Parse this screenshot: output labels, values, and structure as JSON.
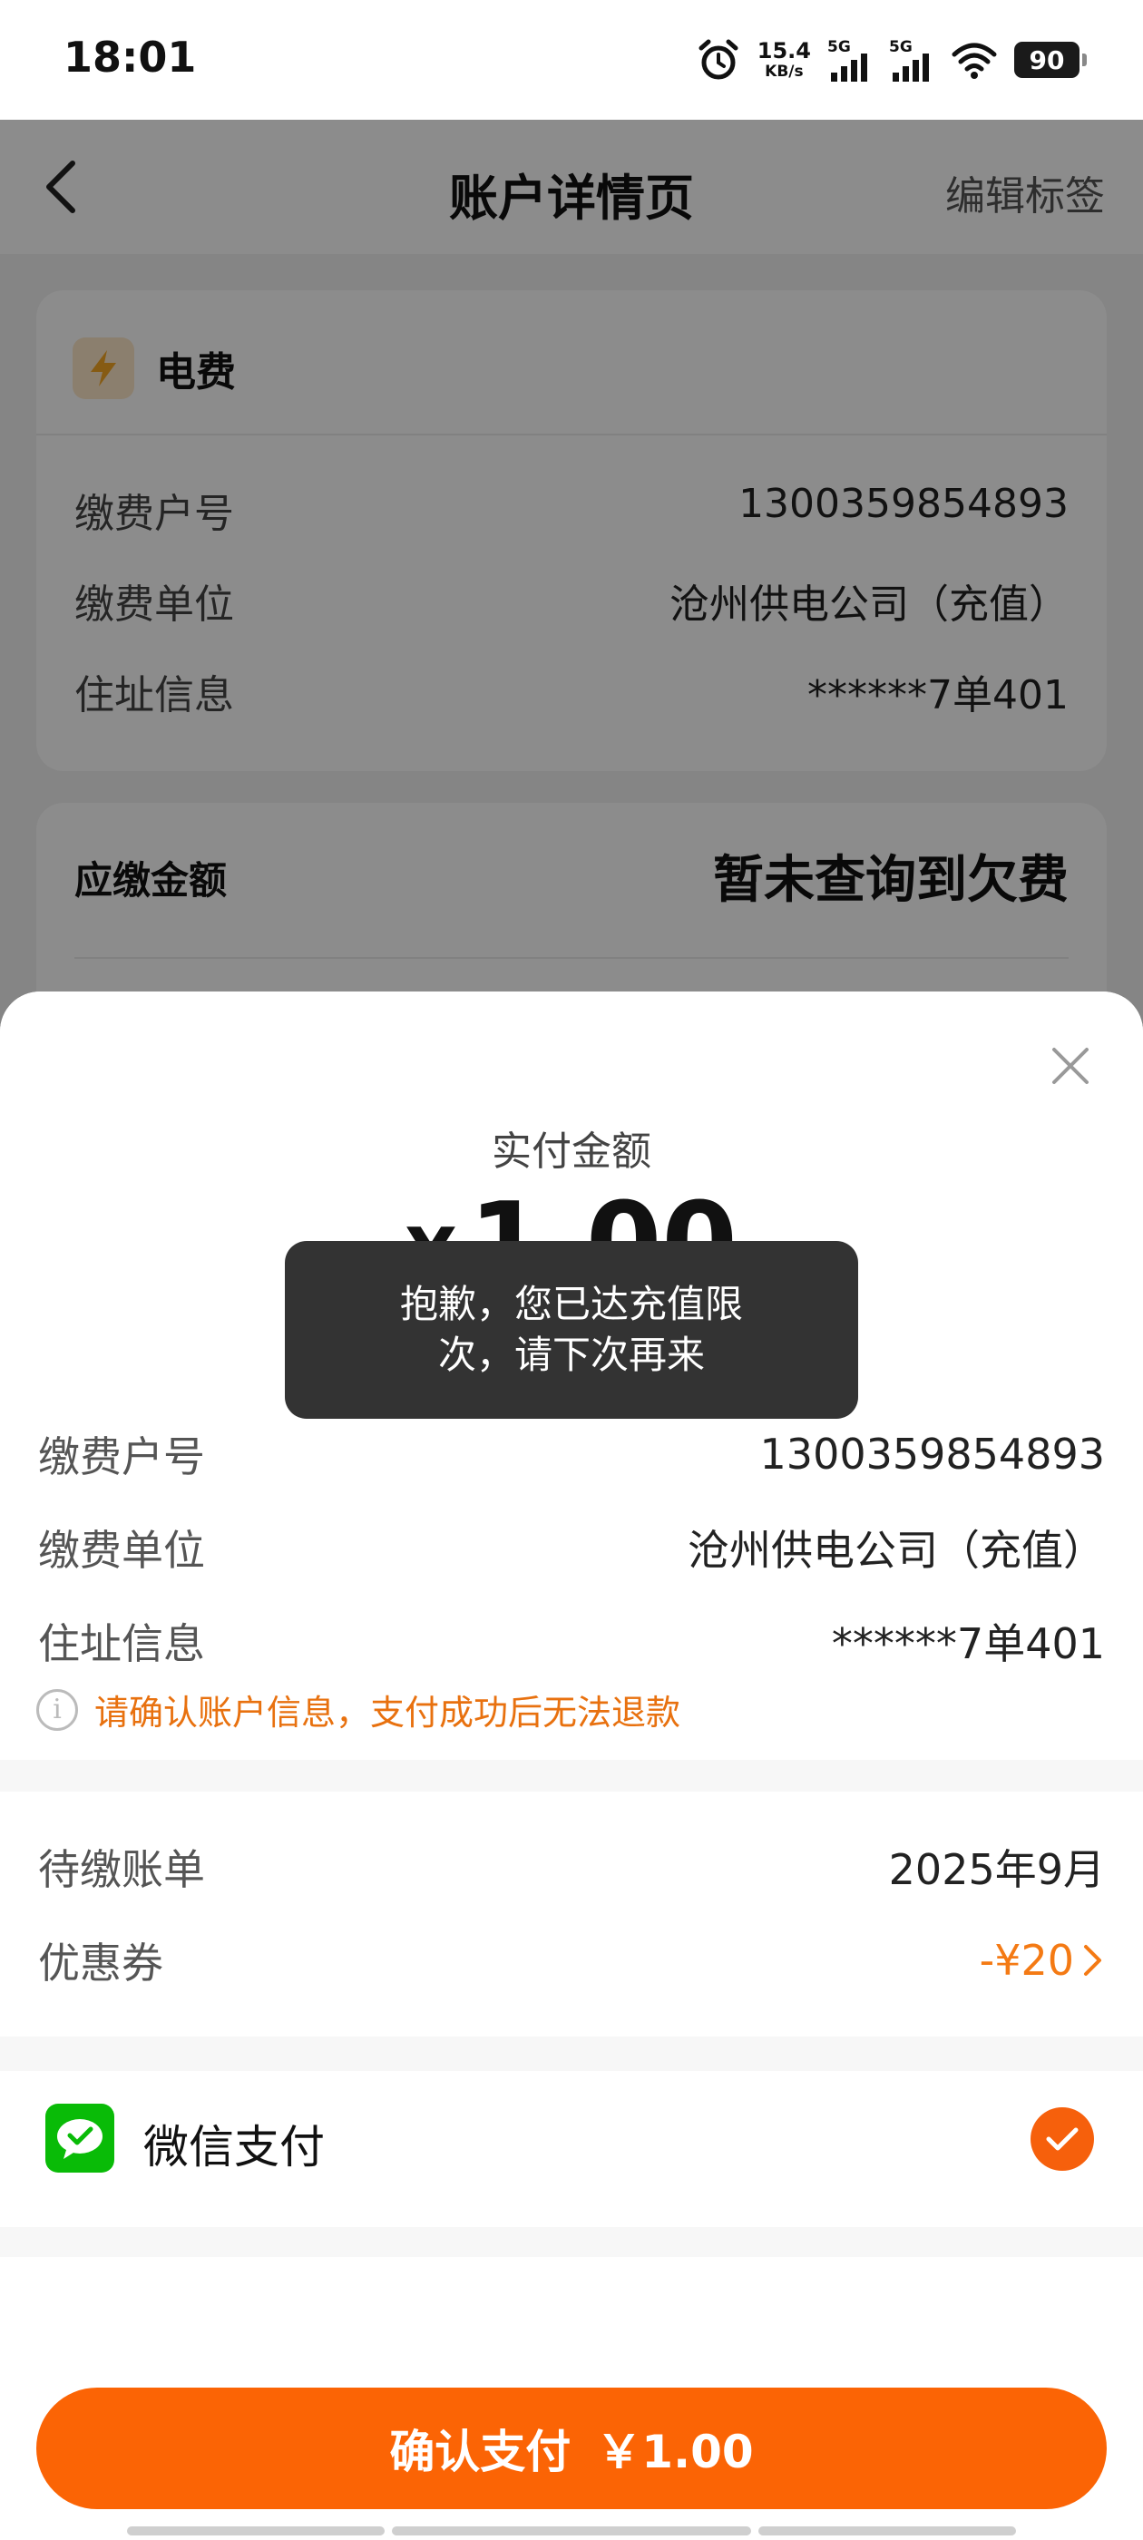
{
  "status_bar": {
    "time": "18:01",
    "net_speed_value": "15.4",
    "net_speed_unit": "KB/s",
    "signal1_label": "5G",
    "signal2_label": "5G",
    "battery": "90",
    "icons": [
      "alarm-icon",
      "signal-icon",
      "wifi-icon",
      "battery-icon"
    ]
  },
  "header": {
    "title": "账户详情页",
    "edit_label": "编辑标签"
  },
  "background_card": {
    "category": "电费",
    "rows": [
      {
        "label": "缴费户号",
        "value": "1300359854893"
      },
      {
        "label": "缴费单位",
        "value": "沧州供电公司（充值）"
      },
      {
        "label": "住址信息",
        "value": "******7单401"
      }
    ]
  },
  "amount_due_card": {
    "label": "应缴金额",
    "value": "暂未查询到欠费"
  },
  "sheet": {
    "pay_label": "实付金额",
    "currency": "¥",
    "amount": "1.00",
    "toast": "抱歉，您已达充值限次，请下次再来",
    "rows": [
      {
        "label": "缴费户号",
        "value": "1300359854893"
      },
      {
        "label": "缴费单位",
        "value": "沧州供电公司（充值）"
      },
      {
        "label": "住址信息",
        "value": "******7单401"
      }
    ],
    "warning": "请确认账户信息，支付成功后无法退款",
    "bill": {
      "label": "待缴账单",
      "value": "2025年9月"
    },
    "coupon": {
      "label": "优惠券",
      "value": "-¥20"
    },
    "payment_method": "微信支付",
    "confirm_label": "确认支付",
    "confirm_amount": "￥1.00"
  },
  "colors": {
    "accent": "#fb6405",
    "warning": "#e8710f",
    "wechat": "#09bb07"
  }
}
